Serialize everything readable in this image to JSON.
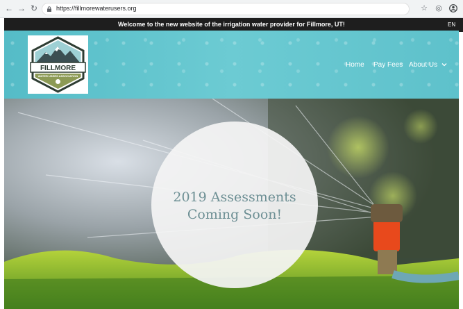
{
  "browser": {
    "url": "https://fillmorewaterusers.org",
    "back_icon": "arrow-left-icon",
    "forward_icon": "arrow-right-icon",
    "reload_icon": "reload-icon"
  },
  "banner": {
    "text": "Welcome to the new website of the irrigation water provider for Fillmore, UT!"
  },
  "language": {
    "label": "EN"
  },
  "logo": {
    "name": "FILLMORE",
    "subtitle": "WATER USERS ASSOCIATION"
  },
  "nav": {
    "home": "Home",
    "pay_fees": "Pay Fees",
    "about_us": "About Us"
  },
  "hero": {
    "line1": "2019 Assessments",
    "line2": "Coming Soon!"
  },
  "colors": {
    "header": "#5ec1cb",
    "banner": "#1e1e1e",
    "hero_text": "#6d8f94"
  }
}
